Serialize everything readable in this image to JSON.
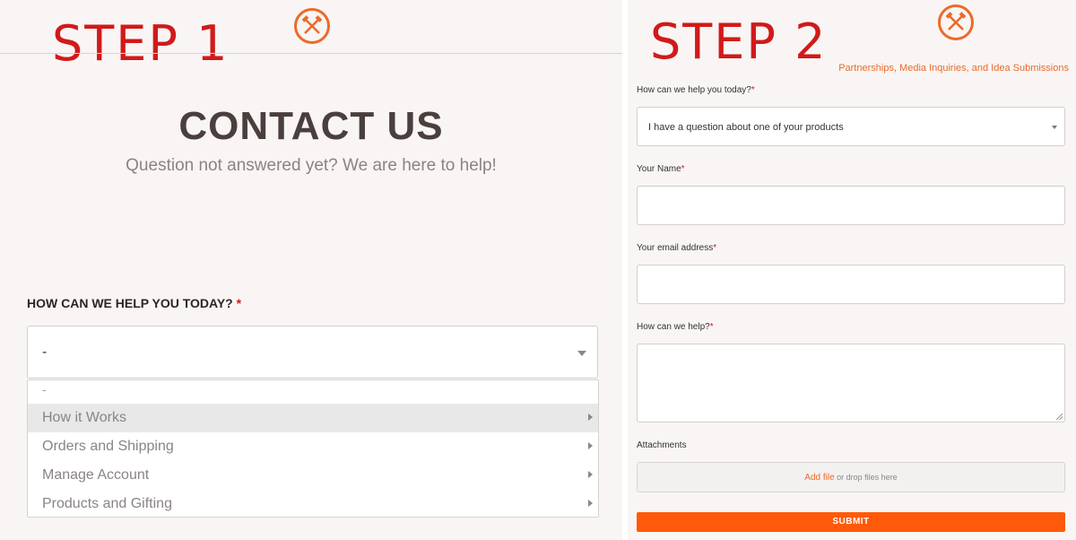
{
  "step1": {
    "label": "STEP 1",
    "title": "CONTACT US",
    "subtitle": "Question not answered yet? We are here to help!",
    "help_label": "HOW CAN WE HELP YOU TODAY?",
    "required_mark": "*",
    "select_value": "-",
    "dropdown": {
      "first": "-",
      "items": [
        {
          "label": "How it Works",
          "highlighted": true
        },
        {
          "label": "Orders and Shipping",
          "highlighted": false
        },
        {
          "label": "Manage Account",
          "highlighted": false
        },
        {
          "label": "Products and Gifting",
          "highlighted": false
        }
      ]
    }
  },
  "step2": {
    "label": "STEP 2",
    "top_link": "Partnerships, Media Inquiries, and Idea Submissions",
    "required_mark": "*",
    "help_label": "How can we help you today?",
    "help_value": "I have a question about one of your products",
    "name_label": "Your Name",
    "name_value": "",
    "email_label": "Your email address",
    "email_value": "",
    "message_label": "How can we help?",
    "message_value": "",
    "attachments_label": "Attachments",
    "add_file": "Add file",
    "drop_text": "or drop files here",
    "submit": "SUBMIT"
  },
  "colors": {
    "accent": "#ec6a2a",
    "submit_bg": "#ff5a0a",
    "step_label": "#d11a1a",
    "required": "#d11a1a"
  },
  "icons": [
    "crossed-hammers-logo-icon",
    "chevron-down-icon",
    "chevron-right-icon"
  ]
}
